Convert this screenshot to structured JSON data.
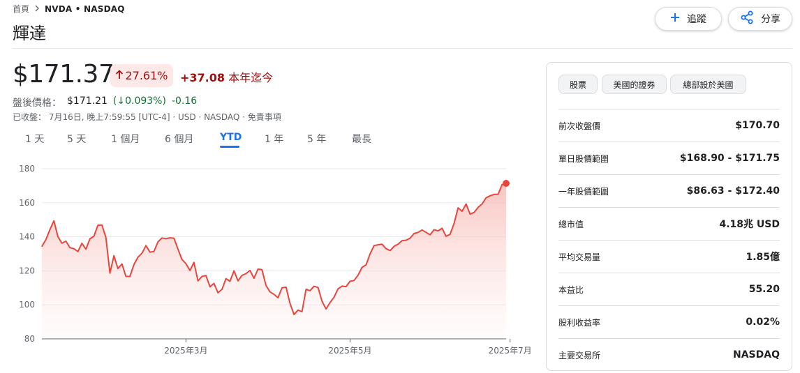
{
  "breadcrumb": {
    "home": "首頁",
    "current": "NVDA • NASDAQ"
  },
  "title": "輝達",
  "actions": {
    "follow_label": "追蹤",
    "share_label": "分享"
  },
  "quote": {
    "price": "$171.37",
    "change_pct": "27.61%",
    "change_abs": "+37.08",
    "period_label": "本年迄今",
    "after_hours_label": "盤後價格：",
    "after_hours_price": "$171.21",
    "after_hours_pct": "(↓0.093%)",
    "after_hours_abs": "-0.16",
    "closed_info": "已收盤： 7月16日, 晚上7:59:55 [UTC-4] · USD · NASDAQ · 免責事項"
  },
  "tabs": [
    {
      "label": "1 天"
    },
    {
      "label": "5 天"
    },
    {
      "label": "1 個月"
    },
    {
      "label": "6 個月"
    },
    {
      "label": "YTD",
      "active": true
    },
    {
      "label": "1 年"
    },
    {
      "label": "5 年"
    },
    {
      "label": "最長"
    }
  ],
  "chips": [
    "股票",
    "美國的證券",
    "總部設於美國"
  ],
  "stats": [
    {
      "label": "前次收盤價",
      "value": "$170.70"
    },
    {
      "label": "單日股價範圍",
      "value": "$168.90 - $171.75"
    },
    {
      "label": "一年股價範圍",
      "value": "$86.63 - $172.40"
    },
    {
      "label": "總市值",
      "value": "4.18兆 USD"
    },
    {
      "label": "平均交易量",
      "value": "1.85億"
    },
    {
      "label": "本益比",
      "value": "55.20"
    },
    {
      "label": "股利收益率",
      "value": "0.02%"
    },
    {
      "label": "主要交易所",
      "value": "NASDAQ"
    }
  ],
  "colors": {
    "line": "#e8453c",
    "fill": "#fce8e6",
    "positive": "#a50e0e",
    "after_hours": "#137333",
    "accent": "#1a73e8"
  },
  "chart_data": {
    "type": "area",
    "title": "",
    "xlabel": "",
    "ylabel": "",
    "ylim": [
      80,
      180
    ],
    "yticks": [
      80,
      100,
      120,
      140,
      160,
      180
    ],
    "xticks": [
      {
        "label": "2025年3月",
        "index": 36
      },
      {
        "label": "2025年5月",
        "index": 77
      },
      {
        "label": "2025年7月",
        "index": 117
      }
    ],
    "grid": true,
    "values": [
      134.3,
      138.3,
      144.2,
      149.4,
      140.1,
      136.2,
      137.4,
      133.6,
      133.0,
      131.3,
      136.2,
      132.7,
      138.8,
      140.3,
      146.8,
      146.9,
      139.6,
      118.6,
      128.9,
      121.3,
      124.0,
      116.7,
      116.7,
      123.7,
      128.0,
      130.3,
      134.8,
      131.0,
      131.3,
      137.0,
      139.3,
      138.9,
      139.4,
      139.2,
      132.8,
      126.7,
      124.2,
      120.2,
      124.9,
      114.1,
      116.7,
      117.2,
      110.6,
      112.6,
      107.1,
      109.1,
      115.4,
      113.8,
      120.0,
      114.1,
      117.3,
      118.3,
      120.2,
      115.6,
      121.0,
      120.6,
      111.4,
      107.6,
      106.2,
      104.2,
      110.0,
      110.4,
      100.9,
      94.3,
      96.9,
      96.0,
      109.1,
      108.3,
      110.9,
      110.2,
      102.1,
      97.6,
      101.3,
      104.5,
      109.4,
      111.0,
      110.7,
      113.8,
      114.3,
      117.4,
      122.0,
      123.5,
      129.9,
      134.8,
      135.3,
      135.6,
      133.0,
      131.9,
      134.4,
      135.6,
      137.7,
      138.0,
      139.2,
      141.9,
      142.6,
      144.0,
      142.6,
      141.2,
      144.2,
      143.5,
      145.0,
      140.3,
      141.4,
      147.9,
      157.0,
      155.0,
      159.3,
      153.3,
      154.3,
      157.3,
      159.3,
      162.9,
      164.1,
      164.9,
      165.0,
      170.7,
      171.4
    ]
  }
}
